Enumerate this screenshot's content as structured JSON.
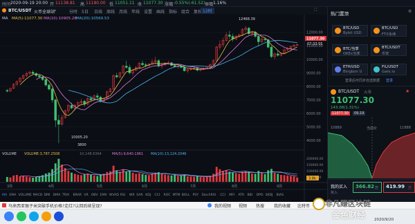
{
  "topbar": {
    "time_label": "时间",
    "datetime": "2020-09-19 20:00",
    "open_label": "开",
    "open": "11138.81",
    "high_label": "高",
    "high": "11180.00",
    "low_label": "低",
    "low": "11051.11",
    "close_label": "收",
    "close": "11077.30",
    "change_label": "涨幅",
    "change": "-0.55%(-61.52)",
    "amplitude_label": "振幅",
    "amplitude": "1.16%"
  },
  "toolbar": {
    "pair": "BTC/USDT",
    "exchange": "火币全球站",
    "items": [
      "分时",
      "5日",
      "日线",
      "周线",
      "月线",
      "年线",
      "设置",
      "画线",
      "指标",
      "组合",
      "复权",
      "更多"
    ],
    "interval": "12时"
  },
  "chart": {
    "ma_label": "MA",
    "ma5_label": "MA(5):11077.30",
    "ma10_label": "MA(10):10905.28",
    "ma20_label": "MA(20):10569.53",
    "price_scale": [
      "12000.00",
      "11000.00",
      "10000.00",
      "9000.00",
      "8000.00",
      "7000.00",
      "6000.00",
      "5000.00",
      "4000.00"
    ],
    "current_price": "11077.30",
    "countdown": "07:33:55",
    "high_marker": "12468.39",
    "low_marker": "3800",
    "low_side_label": "10005.20",
    "volume_label": "VOLUME",
    "vol_value": "VOLUME:3,787.2508",
    "vol_ma5": "MA(5):9,640.1961",
    "vol_ma10": "MA(10):13,124.2046",
    "vol_mid": "10,148.6364",
    "vol_scale": [
      "200000.00",
      "150000.00",
      "100000.00",
      "50000.00"
    ],
    "vol_current": "3.8k",
    "months": [
      "3月",
      "4月",
      "5月",
      "6月",
      "7月",
      "8月",
      "9月"
    ],
    "indicators": [
      "MA",
      "EMA",
      "VOLUME",
      "MACD",
      "DMI",
      "DMA",
      "TRIX",
      "BRAR",
      "VR",
      "OBV",
      "EMV",
      "WVAD",
      "RSI",
      "WR",
      "SAR",
      "KDJ",
      "CCI",
      "ROC",
      "MTM",
      "BOLL",
      "PSY",
      "StochRSI",
      "CCI",
      "MFI",
      "ATR",
      "BBI",
      "DPO",
      "SKDJ",
      "BIAS"
    ],
    "ohlc": [
      [
        7700,
        7800,
        7550,
        7650
      ],
      [
        7650,
        7900,
        7600,
        7850
      ],
      [
        7850,
        8250,
        7800,
        8150
      ],
      [
        8150,
        8450,
        8050,
        8350
      ],
      [
        8350,
        8700,
        8250,
        8600
      ],
      [
        8600,
        8900,
        8500,
        8800
      ],
      [
        8800,
        9100,
        8700,
        8950
      ],
      [
        8950,
        9150,
        8850,
        9050
      ],
      [
        9050,
        9200,
        8900,
        8950
      ],
      [
        8950,
        9050,
        8700,
        8800
      ],
      [
        8800,
        8900,
        8600,
        8700
      ],
      [
        8700,
        8800,
        8400,
        8500
      ],
      [
        8500,
        8600,
        8000,
        8100
      ],
      [
        8100,
        8200,
        7700,
        7800
      ],
      [
        7800,
        7900,
        6800,
        7000
      ],
      [
        7000,
        7100,
        5000,
        5500
      ],
      [
        5500,
        5900,
        3800,
        5200
      ],
      [
        5200,
        5900,
        5100,
        5700
      ],
      [
        5700,
        6300,
        5600,
        6200
      ],
      [
        6200,
        6700,
        6000,
        6600
      ],
      [
        6600,
        6800,
        6300,
        6400
      ],
      [
        6400,
        6700,
        6200,
        6600
      ],
      [
        6600,
        6900,
        6500,
        6800
      ],
      [
        6800,
        7100,
        6600,
        6900
      ],
      [
        6900,
        7000,
        6500,
        6700
      ],
      [
        6700,
        7200,
        6600,
        7100
      ],
      [
        7100,
        7300,
        6900,
        7000
      ],
      [
        7000,
        7400,
        6900,
        7300
      ],
      [
        7300,
        7500,
        7100,
        7200
      ],
      [
        7200,
        7300,
        6800,
        6900
      ],
      [
        6900,
        7200,
        6800,
        7100
      ],
      [
        7100,
        7700,
        7000,
        7600
      ],
      [
        7600,
        7900,
        7500,
        7800
      ],
      [
        7800,
        8900,
        7700,
        8800
      ],
      [
        8800,
        9000,
        8600,
        8700
      ],
      [
        8700,
        9100,
        8600,
        9000
      ],
      [
        9000,
        9600,
        8900,
        9500
      ],
      [
        9500,
        9900,
        9300,
        9400
      ],
      [
        9400,
        9600,
        8900,
        9000
      ],
      [
        9000,
        9300,
        8800,
        9200
      ],
      [
        9200,
        9500,
        9100,
        9400
      ],
      [
        9400,
        9800,
        9300,
        9700
      ],
      [
        9700,
        9900,
        9500,
        9600
      ],
      [
        9600,
        9750,
        9400,
        9550
      ],
      [
        9550,
        9700,
        9450,
        9650
      ],
      [
        9650,
        10000,
        9600,
        9800
      ],
      [
        9800,
        10200,
        9700,
        9900
      ],
      [
        9900,
        10000,
        9400,
        9500
      ],
      [
        9500,
        9700,
        9300,
        9600
      ],
      [
        9600,
        9800,
        9500,
        9700
      ],
      [
        9700,
        9900,
        9600,
        9750
      ],
      [
        9750,
        9800,
        9500,
        9550
      ],
      [
        9550,
        9650,
        9400,
        9450
      ],
      [
        9450,
        9550,
        9300,
        9500
      ],
      [
        9500,
        9600,
        9350,
        9400
      ],
      [
        9400,
        9500,
        9100,
        9150
      ],
      [
        9150,
        9300,
        9000,
        9250
      ],
      [
        9250,
        9400,
        9150,
        9300
      ],
      [
        9300,
        9450,
        9200,
        9350
      ],
      [
        9350,
        9400,
        9100,
        9200
      ],
      [
        9200,
        9300,
        9100,
        9250
      ],
      [
        9250,
        9400,
        9200,
        9300
      ],
      [
        9300,
        9450,
        9250,
        9400
      ],
      [
        9400,
        9700,
        9350,
        9600
      ],
      [
        9600,
        10000,
        9550,
        9900
      ],
      [
        9900,
        11000,
        9850,
        10900
      ],
      [
        10900,
        11400,
        10700,
        11100
      ],
      [
        11100,
        11600,
        10900,
        11400
      ],
      [
        11400,
        12000,
        11300,
        11800
      ],
      [
        11800,
        12100,
        11500,
        11700
      ],
      [
        11700,
        11900,
        11300,
        11500
      ],
      [
        11500,
        11800,
        11400,
        11700
      ],
      [
        11700,
        11900,
        11600,
        11800
      ],
      [
        11800,
        12300,
        11700,
        12200
      ],
      [
        12200,
        12468,
        12000,
        12300
      ],
      [
        12300,
        12400,
        11800,
        11900
      ],
      [
        11900,
        12100,
        11700,
        12000
      ],
      [
        12000,
        12100,
        11600,
        11700
      ],
      [
        11700,
        11800,
        11000,
        11300
      ],
      [
        11300,
        11600,
        11200,
        11500
      ],
      [
        11500,
        11600,
        11300,
        11450
      ],
      [
        11450,
        11500,
        10800,
        10900
      ],
      [
        10900,
        11000,
        10100,
        10200
      ],
      [
        10200,
        10500,
        10000,
        10400
      ],
      [
        10400,
        10600,
        10200,
        10300
      ],
      [
        10300,
        10500,
        10200,
        10450
      ],
      [
        10450,
        10800,
        10400,
        10700
      ],
      [
        10700,
        10900,
        10600,
        10800
      ],
      [
        10800,
        11000,
        10700,
        10950
      ],
      [
        10950,
        11100,
        10900,
        11050
      ],
      [
        11050,
        11180,
        11051,
        11077
      ]
    ],
    "volumes": [
      42,
      38,
      55,
      60,
      48,
      52,
      45,
      40,
      36,
      44,
      50,
      58,
      72,
      80,
      110,
      160,
      200,
      150,
      120,
      95,
      80,
      70,
      62,
      58,
      66,
      72,
      60,
      55,
      50,
      64,
      70,
      85,
      92,
      140,
      100,
      88,
      110,
      90,
      96,
      80,
      70,
      75,
      68,
      60,
      58,
      72,
      80,
      84,
      70,
      62,
      58,
      55,
      60,
      52,
      56,
      62,
      48,
      46,
      44,
      50,
      42,
      40,
      45,
      52,
      70,
      130,
      110,
      95,
      100,
      88,
      82,
      76,
      70,
      86,
      90,
      88,
      72,
      70,
      95,
      78,
      66,
      100,
      112,
      80,
      70,
      60,
      58,
      55,
      52,
      50,
      38
    ]
  },
  "right": {
    "header": "热门置顶",
    "favorites": [
      {
        "name": "BTC/USD",
        "sub": "Bybit USD"
      },
      {
        "name": "BTC/USD",
        "sub": "FTX永续"
      },
      {
        "name": "BTC/当季",
        "sub": "OKEx当季"
      },
      {
        "name": "BTC/USDT",
        "sub": "币安"
      },
      {
        "name": "ETH/USD",
        "sub": "Bingbon U"
      },
      {
        "name": "FIL/USDT",
        "sub": "Gate.io"
      }
    ],
    "login_prompt": "登录后可同步自选数据",
    "login_link": "登录",
    "pair": "BTC/USDT",
    "pair_sub": "火币",
    "price": "11077.30",
    "change": "143.08(1.31%)",
    "badge1": "11077.30",
    "badge2": "09.19",
    "depth_left": "10889",
    "depth_mid": "当前价",
    "depth_right": "11888",
    "buy_label": "我的买入",
    "buy_sub": "买入",
    "price_a": "366.82",
    "price_a_unit": "万",
    "price_b": "419.99",
    "price_b_unit": "万"
  },
  "taskbar": {
    "search_text": "马来西亚猴子米突破手机价格?走红?认回后续呈现?",
    "nav_items": [
      "我的视频",
      "视频",
      "热搜",
      "我的收藏"
    ],
    "site_link": "比特币",
    "watermark": "非凡赚区块链",
    "date": "2020/9/20",
    "brand": "金色财经"
  }
}
